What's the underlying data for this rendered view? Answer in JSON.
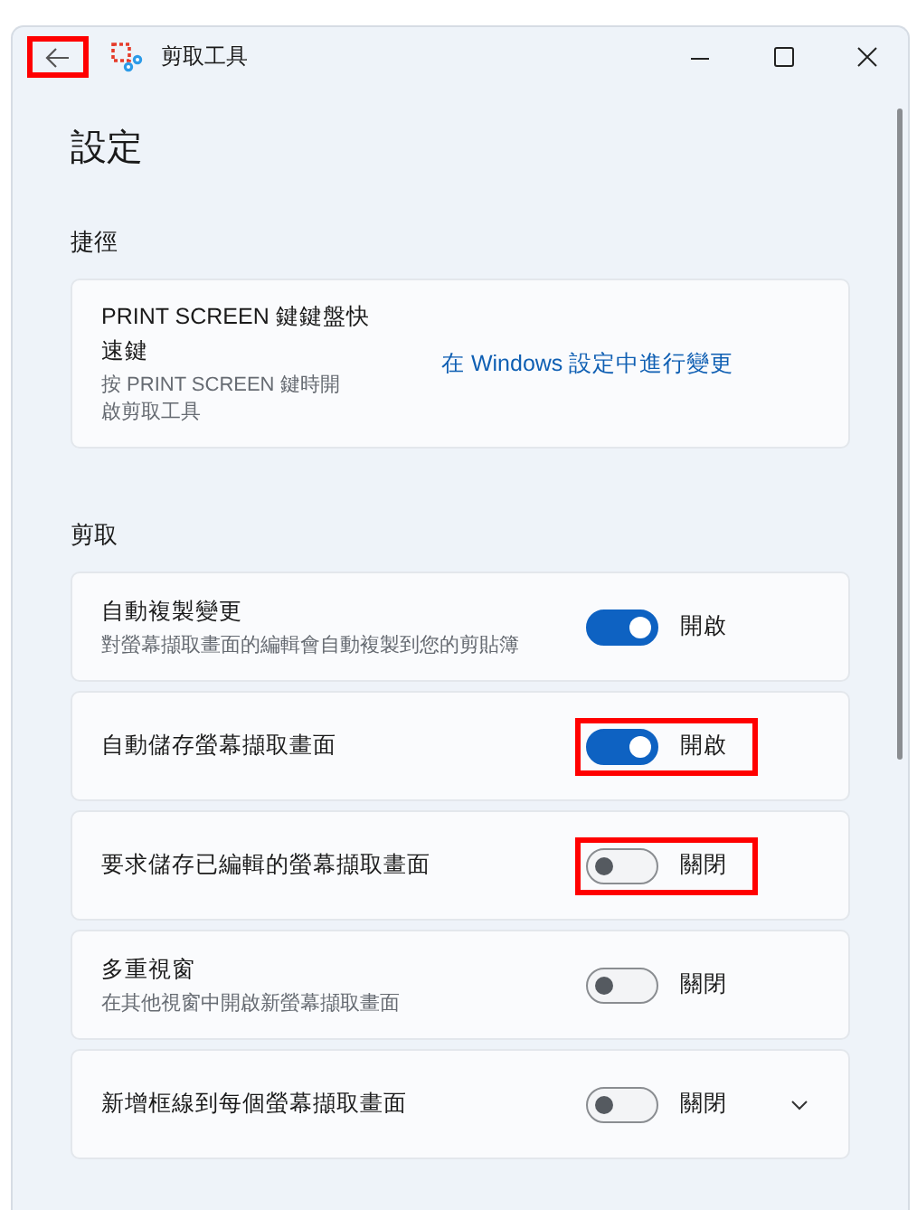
{
  "window": {
    "title": "剪取工具",
    "back_highlighted": true
  },
  "heading": "設定",
  "sections": [
    {
      "title": "捷徑",
      "items": [
        {
          "kind": "link",
          "title": "PRINT SCREEN 鍵鍵盤快速鍵",
          "description": "按 PRINT SCREEN 鍵時開啟剪取工具",
          "link": "在 Windows 設定中進行變更"
        }
      ]
    },
    {
      "title": "剪取",
      "items": [
        {
          "kind": "toggle",
          "title": "自動複製變更",
          "description": "對螢幕擷取畫面的編輯會自動複製到您的剪貼簿",
          "on": true,
          "state_label": "開啟",
          "highlighted": false
        },
        {
          "kind": "toggle",
          "title": "自動儲存螢幕擷取畫面",
          "on": true,
          "state_label": "開啟",
          "highlighted": true
        },
        {
          "kind": "toggle",
          "title": "要求儲存已編輯的螢幕擷取畫面",
          "on": false,
          "state_label": "關閉",
          "highlighted": true
        },
        {
          "kind": "toggle",
          "title": "多重視窗",
          "description": "在其他視窗中開啟新螢幕擷取畫面",
          "on": false,
          "state_label": "關閉",
          "highlighted": false
        },
        {
          "kind": "expander",
          "title": "新增框線到每個螢幕擷取畫面",
          "on": false,
          "state_label": "關閉",
          "highlighted": false,
          "expanded": false
        }
      ]
    }
  ]
}
